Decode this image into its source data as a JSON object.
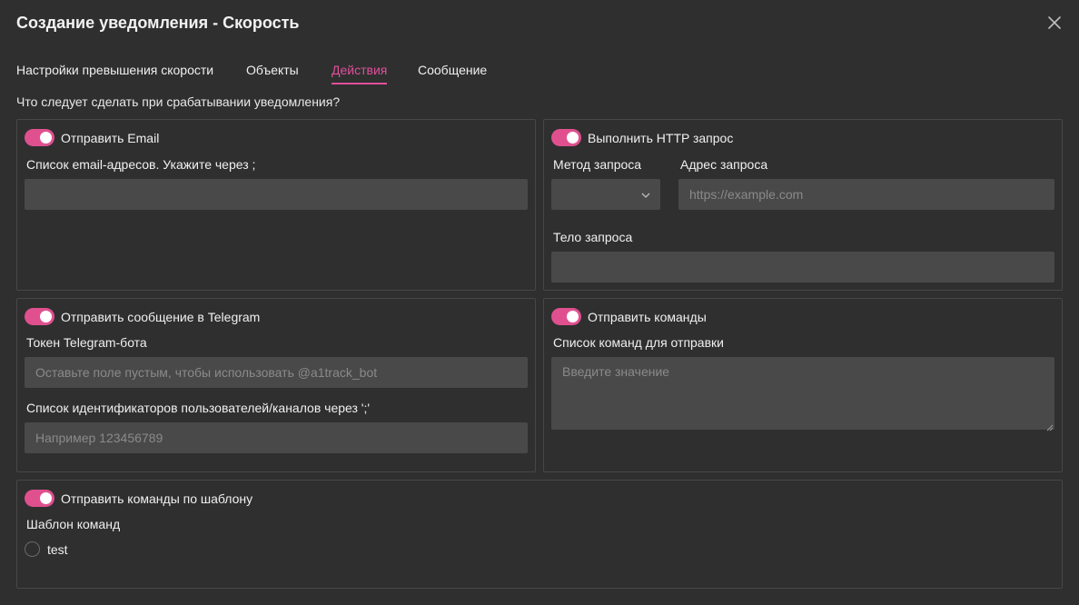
{
  "dialog": {
    "title": "Создание уведомления - Скорость"
  },
  "tabs": [
    {
      "label": "Настройки превышения скорости",
      "active": false
    },
    {
      "label": "Объекты",
      "active": false
    },
    {
      "label": "Действия",
      "active": true
    },
    {
      "label": "Сообщение",
      "active": false
    }
  ],
  "question": "Что следует сделать при срабатывании уведомления?",
  "email": {
    "toggle_label": "Отправить Email",
    "enabled": true,
    "list_label": "Список email-адресов. Укажите через ;",
    "list_value": ""
  },
  "http": {
    "toggle_label": "Выполнить HTTP запрос",
    "enabled": true,
    "method_label": "Метод запроса",
    "method_value": "",
    "url_label": "Адрес запроса",
    "url_placeholder": "https://example.com",
    "body_label": "Тело запроса",
    "body_value": ""
  },
  "telegram": {
    "toggle_label": "Отправить сообщение в Telegram",
    "enabled": true,
    "token_label": "Токен Telegram-бота",
    "token_placeholder": "Оставьте поле пустым, чтобы использовать @a1track_bot",
    "ids_label": "Список идентификаторов пользователей/каналов через ';'",
    "ids_placeholder": "Например 123456789"
  },
  "commands": {
    "toggle_label": "Отправить команды",
    "enabled": true,
    "list_label": "Список команд для отправки",
    "list_placeholder": "Введите значение"
  },
  "template": {
    "toggle_label": "Отправить команды по шаблону",
    "enabled": true,
    "label": "Шаблон команд",
    "options": [
      {
        "label": "test",
        "selected": false
      }
    ]
  },
  "colors": {
    "accent": "#e0509a",
    "background": "#2f2f2f",
    "input_bg": "#494949",
    "border": "#474747"
  }
}
